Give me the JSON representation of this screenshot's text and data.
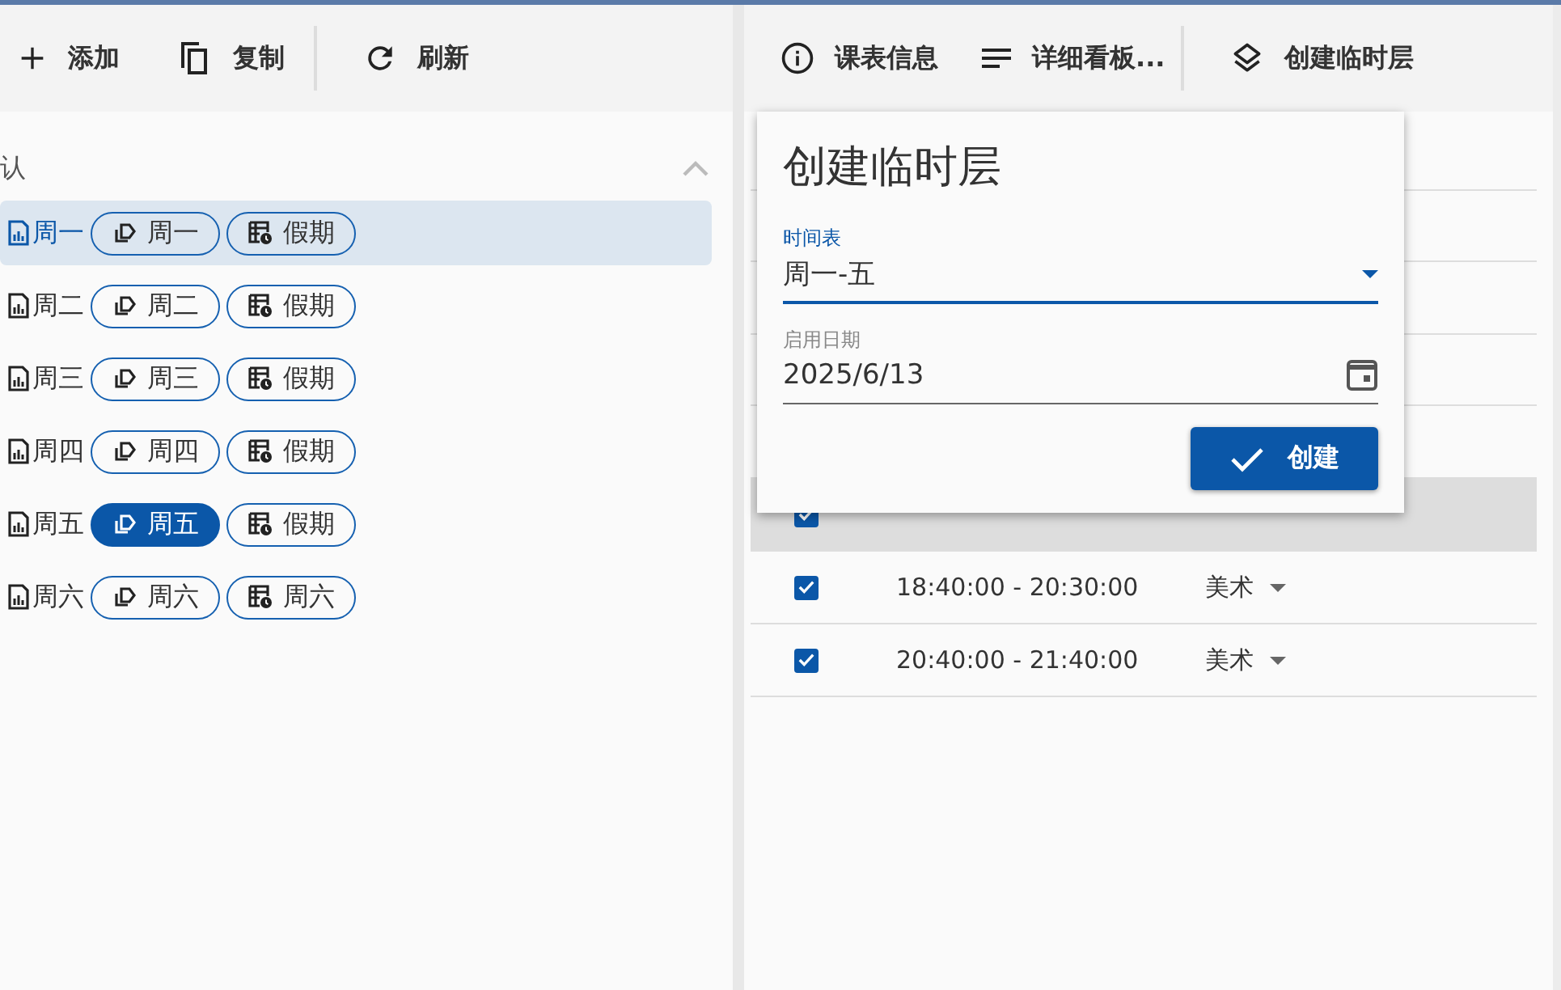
{
  "left_toolbar": [
    {
      "label": "添加"
    },
    {
      "label": "复制"
    },
    {
      "label": "刷新"
    }
  ],
  "right_toolbar": [
    {
      "label": "课表信息"
    },
    {
      "label": "详细看板..."
    },
    {
      "label": "创建临时层"
    }
  ],
  "group": {
    "title": "认",
    "expanded": true,
    "items": [
      {
        "name": "周一",
        "selected": true,
        "chips": [
          {
            "kind": "layer",
            "label": "周一",
            "selected": false
          },
          {
            "kind": "schedule",
            "label": "假期",
            "selected": false
          }
        ]
      },
      {
        "name": "周二",
        "selected": false,
        "chips": [
          {
            "kind": "layer",
            "label": "周二",
            "selected": false
          },
          {
            "kind": "schedule",
            "label": "假期",
            "selected": false
          }
        ]
      },
      {
        "name": "周三",
        "selected": false,
        "chips": [
          {
            "kind": "layer",
            "label": "周三",
            "selected": false
          },
          {
            "kind": "schedule",
            "label": "假期",
            "selected": false
          }
        ]
      },
      {
        "name": "周四",
        "selected": false,
        "chips": [
          {
            "kind": "layer",
            "label": "周四",
            "selected": false
          },
          {
            "kind": "schedule",
            "label": "假期",
            "selected": false
          }
        ]
      },
      {
        "name": "周五",
        "selected": false,
        "chips": [
          {
            "kind": "layer",
            "label": "周五",
            "selected": true
          },
          {
            "kind": "schedule",
            "label": "假期",
            "selected": false
          }
        ]
      },
      {
        "name": "周六",
        "selected": false,
        "chips": [
          {
            "kind": "layer",
            "label": "周六",
            "selected": false
          },
          {
            "kind": "schedule",
            "label": "周六",
            "selected": false
          }
        ]
      }
    ]
  },
  "table": {
    "rows": [
      {
        "checked": true,
        "selected": true
      },
      {
        "checked": true,
        "selected": false,
        "time": "18:40:00 - 20:30:00",
        "subject": "美术"
      },
      {
        "checked": true,
        "selected": false,
        "time": "20:40:00 - 21:40:00",
        "subject": "美术"
      }
    ]
  },
  "dialog": {
    "title": "创建临时层",
    "schedule_field": {
      "label": "时间表",
      "value": "周一-五"
    },
    "date_field": {
      "label": "启用日期",
      "value": "2025/6/13"
    },
    "button": "创建"
  }
}
